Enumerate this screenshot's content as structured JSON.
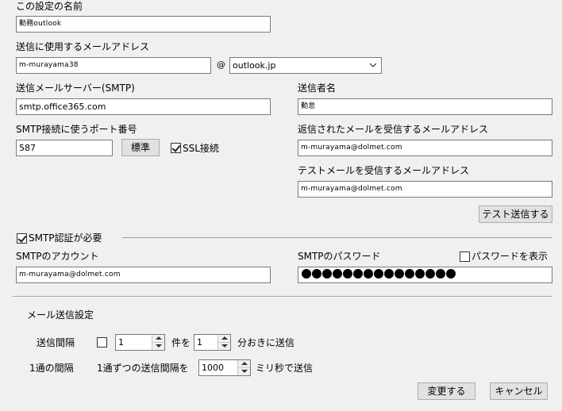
{
  "settings_name": {
    "label": "この設定の名前",
    "value": "勤務outlook"
  },
  "sender_address": {
    "label": "送信に使用するメールアドレス",
    "user": "m-murayama38",
    "at": "@",
    "domain": "outlook.jp"
  },
  "smtp_server": {
    "label": "送信メールサーバー(SMTP)",
    "value": "smtp.office365.com"
  },
  "sender_name": {
    "label": "送信者名",
    "value": "勤怠"
  },
  "smtp_port": {
    "label": "SMTP接続に使うポート番号",
    "value": "587",
    "default_button": "標準",
    "ssl_label": "SSL接続",
    "ssl_checked": true
  },
  "reply_address": {
    "label": "返信されたメールを受信するメールアドレス",
    "value": "m-murayama@dolmet.com"
  },
  "test_address": {
    "label": "テストメールを受信するメールアドレス",
    "value": "m-murayama@dolmet.com"
  },
  "test_button": "テスト送信する",
  "smtp_auth": {
    "label": "SMTP認証が必要",
    "checked": true
  },
  "smtp_account": {
    "label": "SMTPのアカウント",
    "value": "m-murayama@dolmet.com"
  },
  "smtp_password": {
    "label": "SMTPのパスワード",
    "show_label": "パスワードを表示",
    "show_checked": false,
    "mask_count": 15
  },
  "mail_settings": {
    "title": "メール送信設定",
    "interval_label": "送信間隔",
    "interval_checked": false,
    "count_value": "1",
    "count_suffix": "件を",
    "minutes_value": "1",
    "minutes_suffix": "分おきに送信",
    "per_mail_label": "1通の間隔",
    "per_mail_prefix": "1通ずつの送信間隔を",
    "ms_value": "1000",
    "ms_suffix": "ミリ秒で送信"
  },
  "buttons": {
    "apply": "変更する",
    "cancel": "キャンセル"
  }
}
